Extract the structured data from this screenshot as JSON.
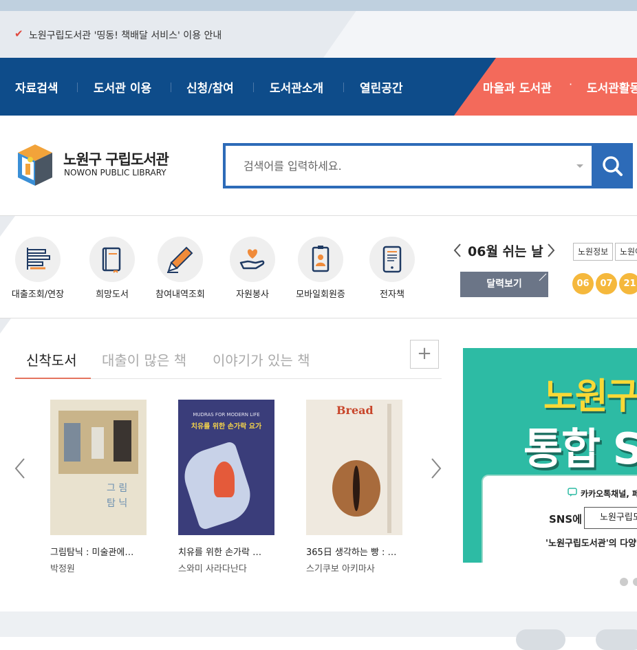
{
  "notice": {
    "text": "노원구립도서관 '띵동! 책배달 서비스' 이용 안내"
  },
  "gnb": {
    "menu": [
      "자료검색",
      "도서관 이용",
      "신청/참여",
      "도서관소개",
      "열린공간"
    ],
    "right_menu": [
      "마을과 도서관",
      "도서관활동"
    ],
    "separator_dot": "·"
  },
  "logo": {
    "name": "노원구 구립도서관",
    "eng": "NOWON PUBLIC LIBRARY"
  },
  "search": {
    "placeholder": "검색어를 입력하세요."
  },
  "quick_links": [
    {
      "label": "대출조회/연장",
      "icon": "list-icon"
    },
    {
      "label": "희망도서",
      "icon": "book-icon"
    },
    {
      "label": "참여내역조회",
      "icon": "pencil-icon"
    },
    {
      "label": "자원봉사",
      "icon": "heart-hand-icon"
    },
    {
      "label": "모바일회원증",
      "icon": "id-badge-icon"
    },
    {
      "label": "전자책",
      "icon": "tablet-icon"
    }
  ],
  "holiday": {
    "title": "06월 쉬는 날",
    "calendar_button": "달력보기",
    "tags": [
      "노원정보",
      "노원어린"
    ],
    "days": [
      "06",
      "07",
      "21"
    ]
  },
  "tabs": {
    "new": "신착도서",
    "popular": "대출이 많은 책",
    "story": "이야기가 있는 책",
    "more": "+"
  },
  "books": [
    {
      "title": "그림탐닉 : 미술관에…",
      "author": "박정원"
    },
    {
      "title": "치유를 위한 손가락 …",
      "author": "스와미 사라다난다"
    },
    {
      "title": "365日 생각하는 빵 : …",
      "author": "스기쿠보 아키마사"
    }
  ],
  "book_covers": {
    "b1_title": "그 림\n탐 닉",
    "b2_top": "MUDRAS FOR MODERN LIFE",
    "b2_title": "치유를 위한 손가락 요가",
    "b3_title": "Bread"
  },
  "banner": {
    "line1": "노원구",
    "line2": "통합 S",
    "kakao": "카카오톡채널, 페",
    "sns_label": "SNS에",
    "sns_box": "노원구립도",
    "bottom": "'노원구립도서관'의 다양"
  },
  "colors": {
    "navy": "#0e4c8a",
    "coral": "#f36a5b",
    "accent_blue": "#2d6bb8",
    "holiday_yellow": "#f5b83c",
    "banner_green": "#2dbba4"
  }
}
